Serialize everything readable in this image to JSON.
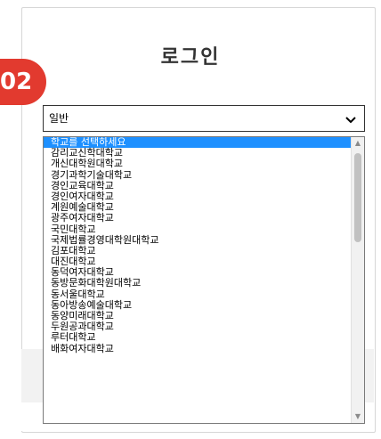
{
  "login": {
    "title": "로그인"
  },
  "step_badge": "02",
  "select": {
    "value": "일반"
  },
  "school_list": {
    "options": [
      "학교를 선택하세요",
      "감리교신학대학교",
      "개신대학원대학교",
      "경기과학기술대학교",
      "경인교육대학교",
      "경인여자대학교",
      "계원예술대학교",
      "광주여자대학교",
      "국민대학교",
      "국제법률경영대학원대학교",
      "김포대학교",
      "대진대학교",
      "동덕여자대학교",
      "동방문화대학원대학교",
      "동서울대학교",
      "동아방송예술대학교",
      "동양미래대학교",
      "두원공과대학교",
      "루터대학교",
      "배화여자대학교"
    ],
    "selected_index": 0,
    "scroll_fraction": 0.0
  },
  "colors": {
    "badge": "#e23a2f",
    "selection": "#1e90ff"
  }
}
